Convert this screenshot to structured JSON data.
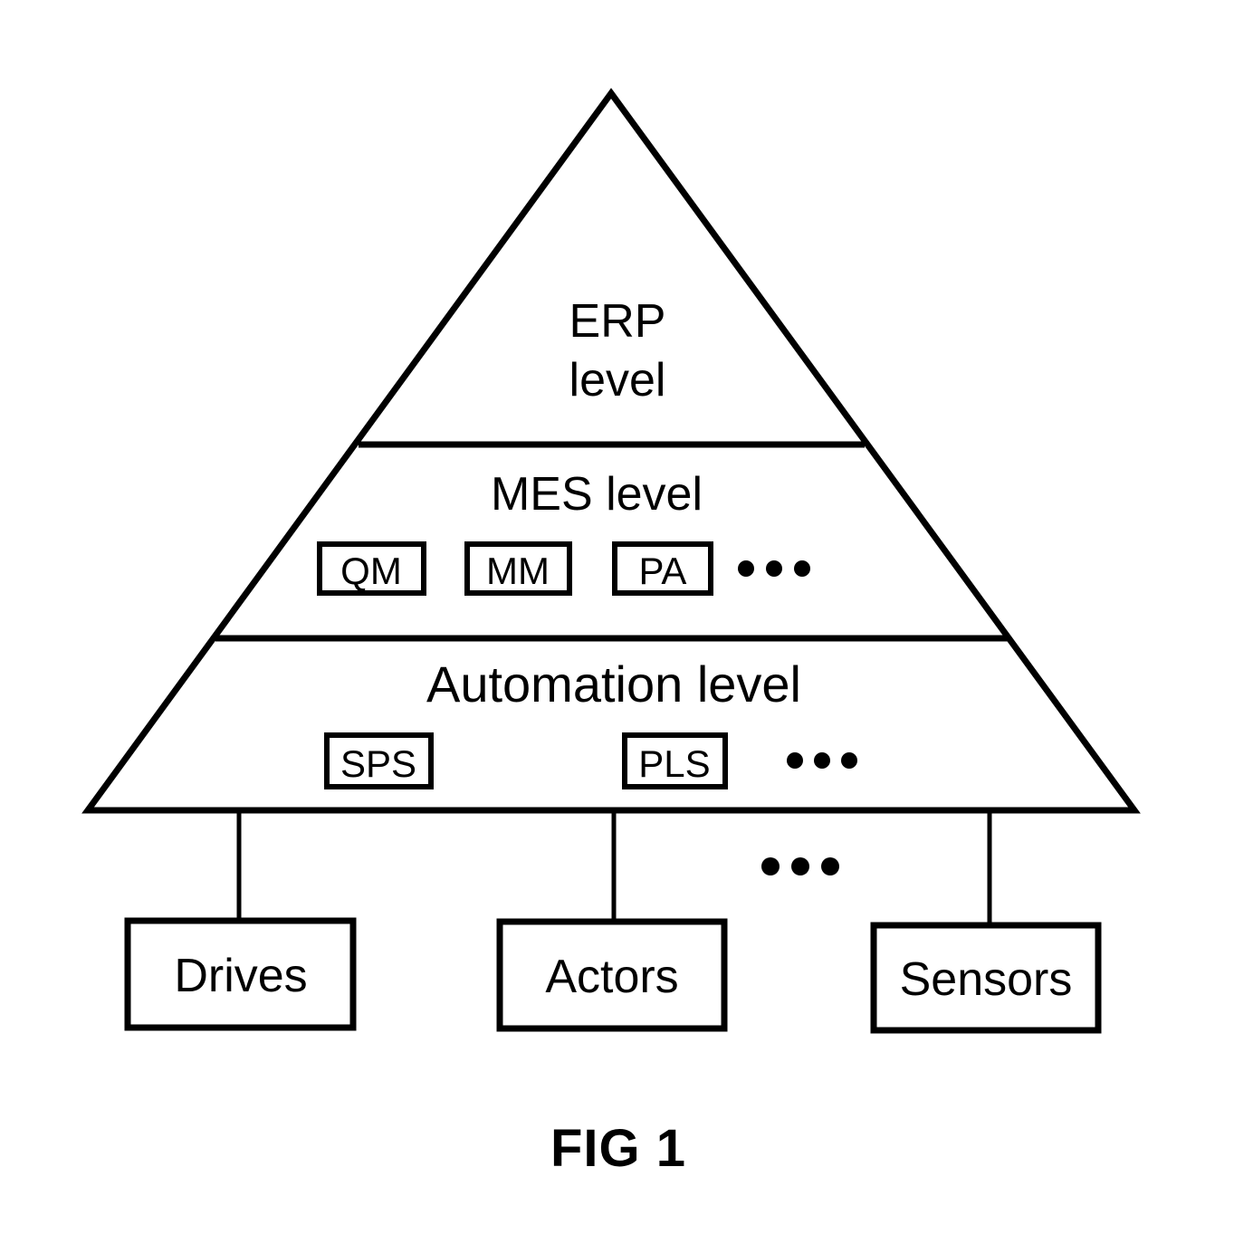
{
  "figure": {
    "caption": "FIG 1",
    "ink_color": "#000000",
    "background_color": "#ffffff"
  },
  "pyramid": {
    "tiers": [
      {
        "id": "erp",
        "title_lines": [
          "ERP",
          "level"
        ],
        "title": "ERP level",
        "chips": [],
        "ellipsis": ""
      },
      {
        "id": "mes",
        "title_lines": [
          "MES level"
        ],
        "title": "MES level",
        "chips": [
          {
            "label": "QM"
          },
          {
            "label": "MM"
          },
          {
            "label": "PA"
          }
        ],
        "ellipsis": "..."
      },
      {
        "id": "automation",
        "title_lines": [
          "Automation level"
        ],
        "title": "Automation level",
        "chips": [
          {
            "label": "SPS"
          },
          {
            "label": "PLS"
          }
        ],
        "ellipsis": "..."
      }
    ]
  },
  "field_devices": {
    "ellipsis": "...",
    "items": [
      {
        "label": "Drives"
      },
      {
        "label": "Actors"
      },
      {
        "label": "Sensors"
      }
    ]
  }
}
